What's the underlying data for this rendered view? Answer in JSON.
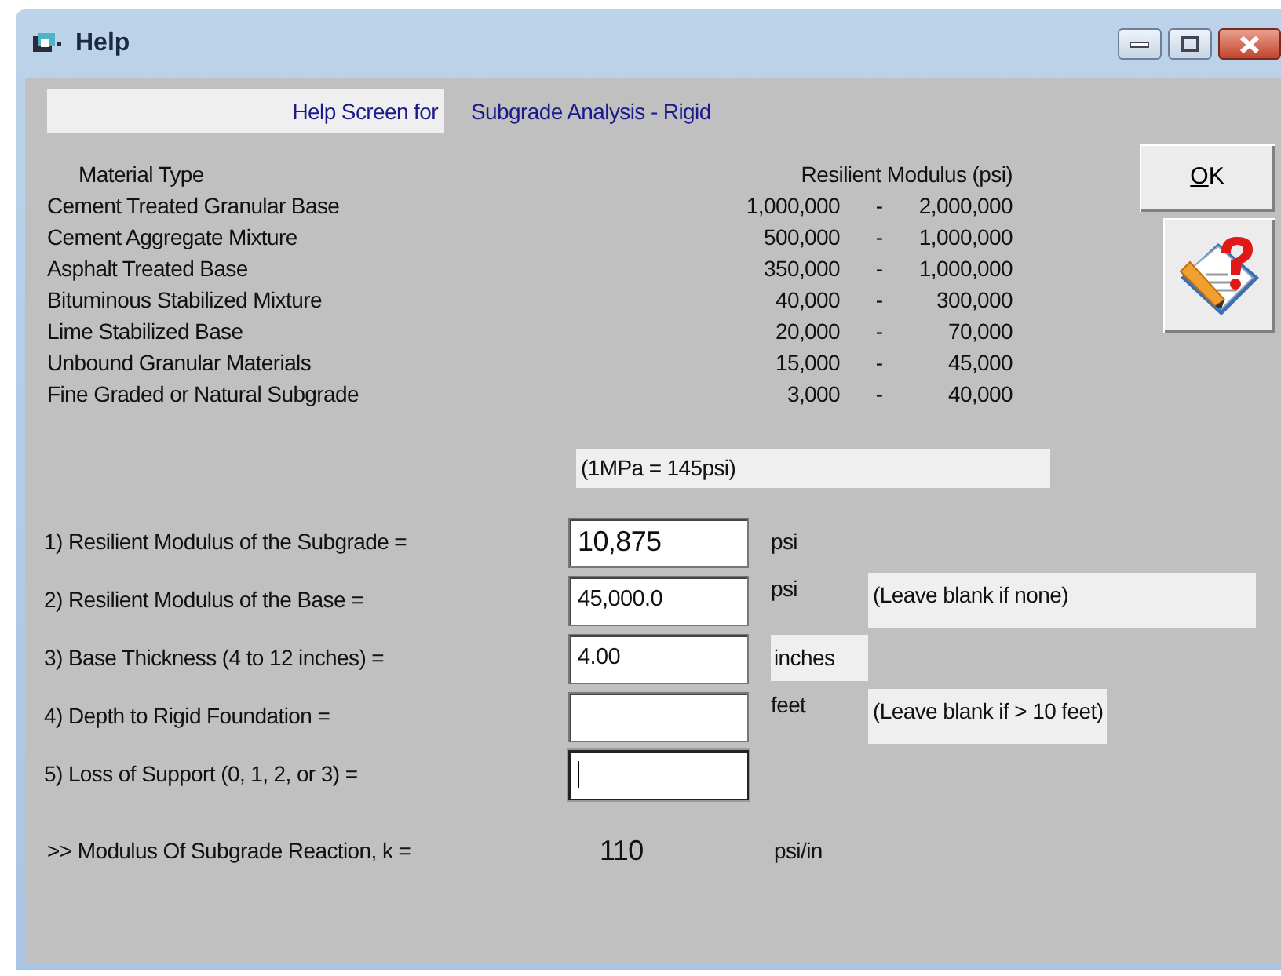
{
  "window": {
    "title": "Help"
  },
  "header": {
    "label": "Help Screen for",
    "topic": "Subgrade Analysis - Rigid"
  },
  "table": {
    "columns": [
      "Material Type",
      "Resilient Modulus (psi)"
    ],
    "rows": [
      {
        "material": "Cement Treated Granular Base",
        "low": "1,000,000",
        "separator": "-",
        "high": "2,000,000"
      },
      {
        "material": "Cement Aggregate Mixture",
        "low": "500,000",
        "separator": "-",
        "high": "1,000,000"
      },
      {
        "material": "Asphalt Treated Base",
        "low": "350,000",
        "separator": "-",
        "high": "1,000,000"
      },
      {
        "material": "Bituminous Stabilized Mixture",
        "low": "40,000",
        "separator": "-",
        "high": "300,000"
      },
      {
        "material": "Lime Stabilized Base",
        "low": "20,000",
        "separator": "-",
        "high": "70,000"
      },
      {
        "material": "Unbound Granular Materials",
        "low": "15,000",
        "separator": "-",
        "high": "45,000"
      },
      {
        "material": "Fine Graded or Natural Subgrade",
        "low": "3,000",
        "separator": "-",
        "high": "40,000"
      }
    ]
  },
  "buttons": {
    "ok": {
      "label_parts": [
        {
          "text": "O",
          "underlined": true
        },
        {
          "text": "K",
          "underlined": false
        }
      ]
    }
  },
  "conversion_note": "(1MPa = 145psi)",
  "inputs": [
    {
      "label": "1) Resilient Modulus of the Subgrade =",
      "value": "10,875",
      "emphasized": true,
      "unit": "psi",
      "unit_boxed": false,
      "focused": false
    },
    {
      "label": "2) Resilient Modulus of the Base =",
      "value": "45,000.0",
      "emphasized": false,
      "unit": "psi",
      "unit_boxed": false,
      "note": "(Leave blank if none)",
      "focused": false
    },
    {
      "label": "3) Base Thickness (4 to 12 inches) =",
      "value": "4.00",
      "emphasized": false,
      "unit": "inches",
      "unit_boxed": true,
      "focused": false
    },
    {
      "label": "4) Depth to Rigid Foundation =",
      "unit": "feet",
      "unit_boxed": false,
      "note": "(Leave blank if > 10 feet)",
      "focused": false
    },
    {
      "label": "5) Loss of Support (0, 1, 2, or 3)  =",
      "focused": true
    }
  ],
  "result": {
    "label": ">> Modulus Of Subgrade Reaction, k =",
    "value": "110",
    "unit": "psi/in"
  }
}
